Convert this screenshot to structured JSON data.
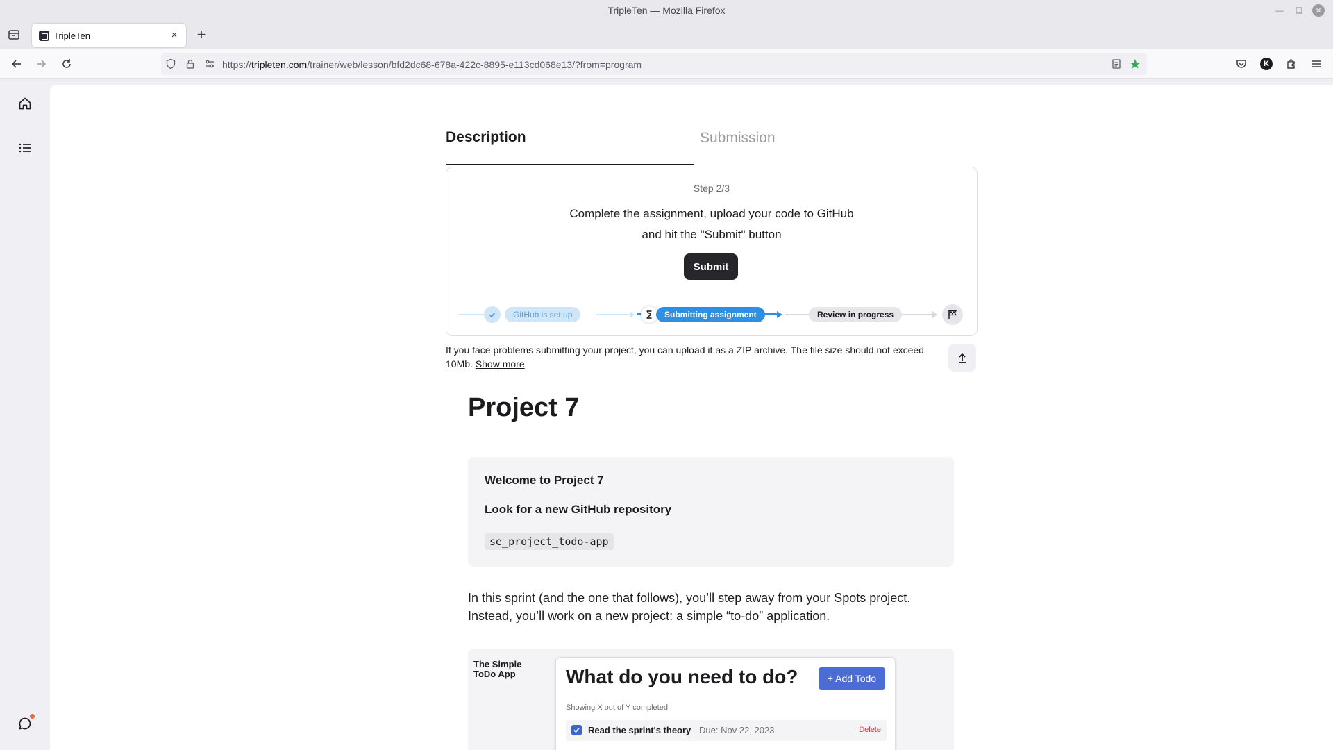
{
  "window": {
    "title": "TripleTen — Mozilla Firefox"
  },
  "browser": {
    "tab": {
      "label": "TripleTen"
    },
    "url": {
      "scheme": "https://",
      "host": "tripleten.com",
      "path": "/trainer/web/lesson/bfd2dc68-678a-422c-8895-e113cd068e13/?from=program"
    },
    "account_initial": "K"
  },
  "lesson": {
    "tabs": {
      "description": "Description",
      "submission": "Submission"
    },
    "step_label": "Step 2/3",
    "instructions_line1": "Complete the assignment, upload your code to GitHub",
    "instructions_line2": "and hit the \"Submit\" button",
    "submit_label": "Submit",
    "progress": {
      "steps": [
        "GitHub is set up",
        "Submitting assignment",
        "Review in progress"
      ],
      "current_step": 2
    },
    "zip_note": "If you face problems submitting your project, you can upload it as a ZIP archive. The file size should not exceed 10Mb.",
    "show_more": "Show more",
    "project_title": "Project 7",
    "info": {
      "welcome": "Welcome to Project 7",
      "repo_heading": "Look for a new GitHub repository",
      "repo_name": "se_project_todo-app"
    },
    "intro_paragraph": "In this sprint (and the one that follows), you’ll step away from your Spots project. Instead, you’ll work on a new project: a simple “to-do” application.",
    "preview": {
      "brand": "The Simple ToDo App",
      "heading": "What do you need to do?",
      "add_button": "+ Add Todo",
      "counter": "Showing X out of Y completed",
      "todo_title": "Read the sprint's theory",
      "todo_due": "Due: Nov 22, 2023",
      "todo_delete": "Delete"
    }
  },
  "colors": {
    "accent_blue": "#2f8fe3",
    "done_blue": "#cfe6f9",
    "primary_dark": "#26262b",
    "notification": "#f0653c"
  }
}
